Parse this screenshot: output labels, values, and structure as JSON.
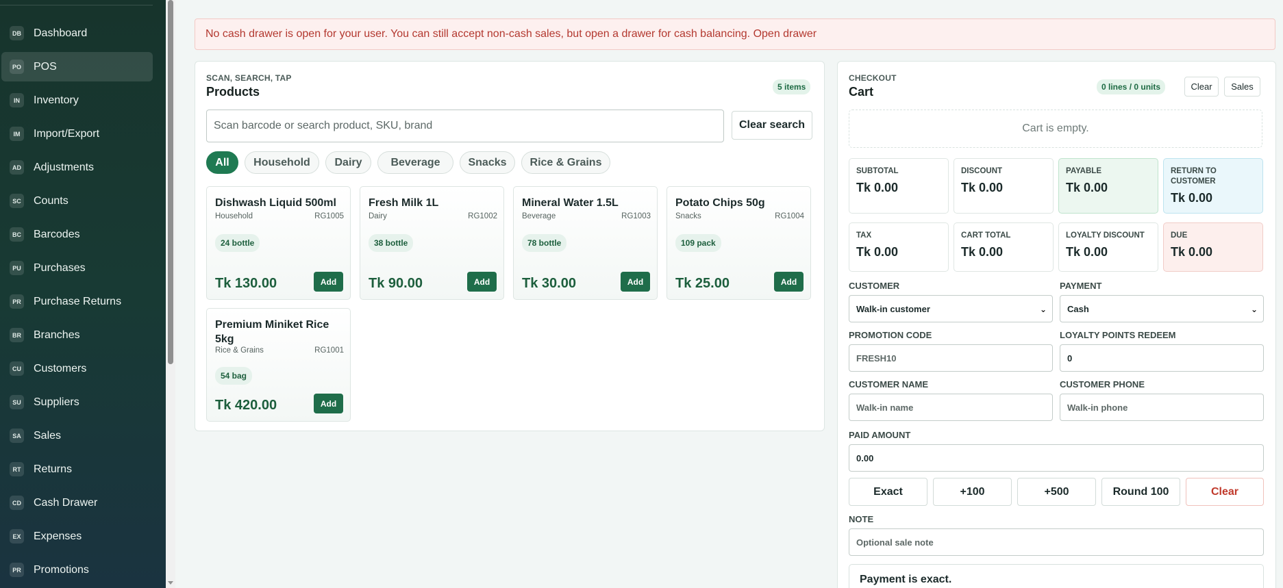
{
  "sidebar": {
    "items": [
      {
        "abbr": "DB",
        "label": "Dashboard"
      },
      {
        "abbr": "PO",
        "label": "POS"
      },
      {
        "abbr": "IN",
        "label": "Inventory"
      },
      {
        "abbr": "IM",
        "label": "Import/Export"
      },
      {
        "abbr": "AD",
        "label": "Adjustments"
      },
      {
        "abbr": "SC",
        "label": "Counts"
      },
      {
        "abbr": "BC",
        "label": "Barcodes"
      },
      {
        "abbr": "PU",
        "label": "Purchases"
      },
      {
        "abbr": "PR",
        "label": "Purchase Returns"
      },
      {
        "abbr": "BR",
        "label": "Branches"
      },
      {
        "abbr": "CU",
        "label": "Customers"
      },
      {
        "abbr": "SU",
        "label": "Suppliers"
      },
      {
        "abbr": "SA",
        "label": "Sales"
      },
      {
        "abbr": "RT",
        "label": "Returns"
      },
      {
        "abbr": "CD",
        "label": "Cash Drawer"
      },
      {
        "abbr": "EX",
        "label": "Expenses"
      },
      {
        "abbr": "PR",
        "label": "Promotions"
      }
    ]
  },
  "alert": {
    "text": "No cash drawer is open for your user. You can still accept non-cash sales, but open a drawer for cash balancing. Open drawer"
  },
  "products": {
    "kicker": "SCAN, SEARCH, TAP",
    "title": "Products",
    "count": "5 items",
    "search_placeholder": "Scan barcode or search product, SKU, brand",
    "clear_search": "Clear search",
    "categories": [
      "All",
      "Household",
      "Dairy",
      "Beverage",
      "Snacks",
      "Rice & Grains"
    ],
    "items": [
      {
        "name": "Dishwash Liquid 500ml",
        "category": "Household",
        "sku": "RG1005",
        "stock": "24 bottle",
        "price": "Tk 130.00",
        "add": "Add"
      },
      {
        "name": "Fresh Milk 1L",
        "category": "Dairy",
        "sku": "RG1002",
        "stock": "38 bottle",
        "price": "Tk 90.00",
        "add": "Add"
      },
      {
        "name": "Mineral Water 1.5L",
        "category": "Beverage",
        "sku": "RG1003",
        "stock": "78 bottle",
        "price": "Tk 30.00",
        "add": "Add"
      },
      {
        "name": "Potato Chips 50g",
        "category": "Snacks",
        "sku": "RG1004",
        "stock": "109 pack",
        "price": "Tk 25.00",
        "add": "Add"
      },
      {
        "name": "Premium Miniket Rice 5kg",
        "category": "Rice & Grains",
        "sku": "RG1001",
        "stock": "54 bag",
        "price": "Tk 420.00",
        "add": "Add"
      }
    ]
  },
  "cart": {
    "kicker": "CHECKOUT",
    "title": "Cart",
    "summary": "0 lines / 0 units",
    "clear": "Clear",
    "sales": "Sales",
    "empty": "Cart is empty.",
    "totals": [
      {
        "label": "SUBTOTAL",
        "value": "Tk 0.00"
      },
      {
        "label": "DISCOUNT",
        "value": "Tk 0.00"
      },
      {
        "label": "PAYABLE",
        "value": "Tk 0.00"
      },
      {
        "label": "RETURN TO CUSTOMER",
        "value": "Tk 0.00"
      },
      {
        "label": "TAX",
        "value": "Tk 0.00"
      },
      {
        "label": "CART TOTAL",
        "value": "Tk 0.00"
      },
      {
        "label": "LOYALTY DISCOUNT",
        "value": "Tk 0.00"
      },
      {
        "label": "DUE",
        "value": "Tk 0.00"
      }
    ],
    "customer_label": "CUSTOMER",
    "customer_value": "Walk-in customer",
    "payment_label": "PAYMENT",
    "payment_value": "Cash",
    "promo_label": "PROMOTION CODE",
    "promo_placeholder": "FRESH10",
    "loyalty_label": "LOYALTY POINTS REDEEM",
    "loyalty_value": "0",
    "cname_label": "CUSTOMER NAME",
    "cname_placeholder": "Walk-in name",
    "cphone_label": "CUSTOMER PHONE",
    "cphone_placeholder": "Walk-in phone",
    "paid_label": "PAID AMOUNT",
    "paid_value": "0.00",
    "quick": [
      "Exact",
      "+100",
      "+500",
      "Round 100",
      "Clear"
    ],
    "note_label": "NOTE",
    "note_placeholder": "Optional sale note",
    "payment_status": "Payment is exact."
  }
}
